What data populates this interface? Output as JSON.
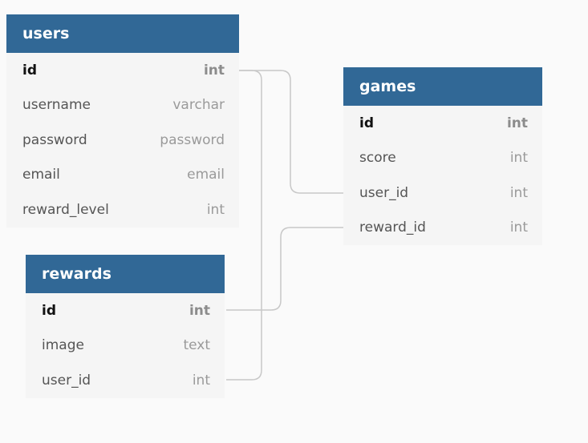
{
  "tables": {
    "users": {
      "title": "users",
      "fields": [
        {
          "name": "id",
          "type": "int",
          "pk": true
        },
        {
          "name": "username",
          "type": "varchar"
        },
        {
          "name": "password",
          "type": "password"
        },
        {
          "name": "email",
          "type": "email"
        },
        {
          "name": "reward_level",
          "type": "int"
        }
      ]
    },
    "games": {
      "title": "games",
      "fields": [
        {
          "name": "id",
          "type": "int",
          "pk": true
        },
        {
          "name": "score",
          "type": "int"
        },
        {
          "name": "user_id",
          "type": "int"
        },
        {
          "name": "reward_id",
          "type": "int"
        }
      ]
    },
    "rewards": {
      "title": "rewards",
      "fields": [
        {
          "name": "id",
          "type": "int",
          "pk": true
        },
        {
          "name": "image",
          "type": "text"
        },
        {
          "name": "user_id",
          "type": "int"
        }
      ]
    }
  },
  "relationships": [
    {
      "from": "users.id",
      "to": "games.user_id"
    },
    {
      "from": "rewards.id",
      "to": "games.reward_id"
    },
    {
      "from": "users.id",
      "to": "rewards.user_id"
    }
  ],
  "colors": {
    "header": "#316896",
    "table_bg": "#f5f5f5",
    "connector": "#c8c8c8",
    "background": "#fafafa"
  }
}
